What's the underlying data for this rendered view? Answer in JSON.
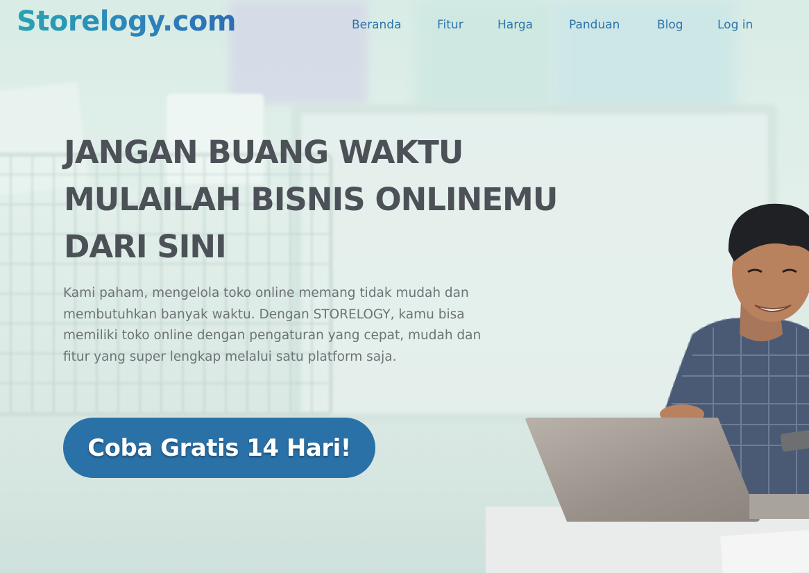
{
  "header": {
    "logo_text": "Storelogy.com",
    "nav": [
      {
        "label": "Beranda"
      },
      {
        "label": "Fitur"
      },
      {
        "label": "Harga"
      },
      {
        "label": "Panduan"
      },
      {
        "label": "Blog"
      },
      {
        "label": "Log in"
      }
    ]
  },
  "hero": {
    "title_lines": [
      "JANGAN BUANG WAKTU",
      "MULAILAH BISNIS ONLINEMU",
      "DARI SINI"
    ],
    "description": "Kami paham, mengelola toko online memang tidak mudah dan membutuhkan banyak waktu. Dengan STORELOGY, kamu bisa memiliki toko online dengan pengaturan yang cepat, mudah dan fitur yang super lengkap melalui satu platform saja.",
    "cta_label": "Coba Gratis 14 Hari!"
  },
  "colors": {
    "brand_blue": "#2a71a8",
    "nav_text": "#2e74ab",
    "title_text": "#4c5158",
    "body_text": "#6d7276"
  },
  "images": {
    "hero_background": "shopping-cart-and-office-photo",
    "hero_person": "smiling-man-with-laptop-photo"
  }
}
